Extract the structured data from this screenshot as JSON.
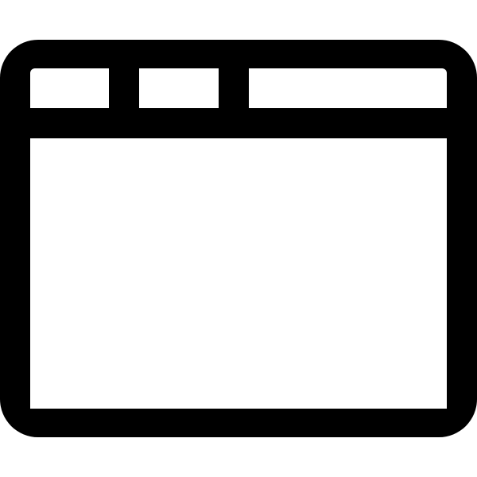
{
  "icon": {
    "name": "browser-window-icon",
    "stroke_color": "#000000",
    "fill_color": "#ffffff",
    "background_color": "#ffffff",
    "tab_count": 3
  }
}
